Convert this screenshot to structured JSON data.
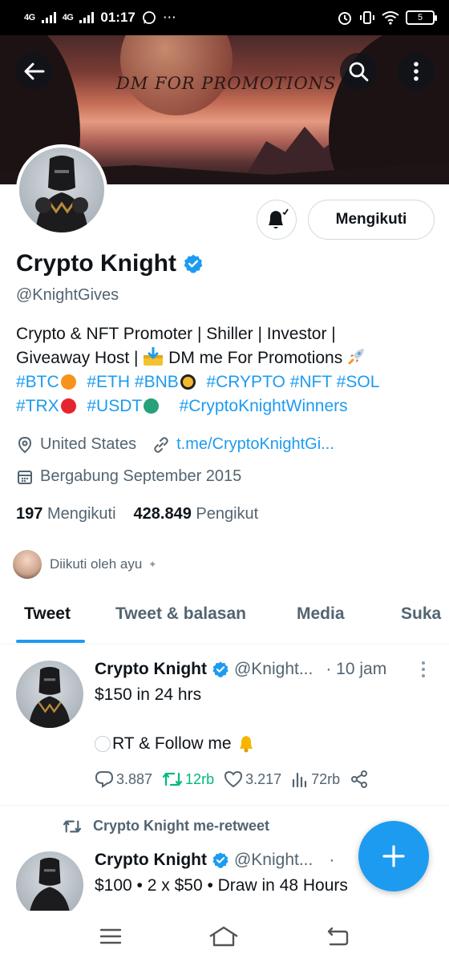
{
  "status_bar": {
    "signal1": "4G",
    "signal2": "4G",
    "time": "01:17",
    "extra": "⋯",
    "battery": "5"
  },
  "banner": {
    "text": "DM FOR PROMOTIONS"
  },
  "profile": {
    "follow_button": "Mengikuti",
    "name": "Crypto Knight",
    "handle": "@KnightGives",
    "bio_line1": "Crypto & NFT Promoter | Shiller | Investor |",
    "bio_line2_a": "Giveaway Host | ",
    "bio_line2_b": " DM me For Promotions ",
    "tags": {
      "btc": "#BTC",
      "eth": "#ETH",
      "bnb": "#BNB",
      "crypto": "#CRYPTO",
      "nft": "#NFT",
      "sol": "#SOL",
      "trx": "#TRX",
      "usdt": "#USDT",
      "winners": "#CryptoKnightWinners"
    },
    "location": "United States",
    "link": "t.me/CryptoKnightGi...",
    "joined": "Bergabung September 2015",
    "following_count": "197",
    "following_label": "Mengikuti",
    "followers_count": "428.849",
    "followers_label": "Pengikut",
    "followed_by": "Diikuti oleh ayu"
  },
  "tabs": [
    "Tweet",
    "Tweet & balasan",
    "Media",
    "Suka"
  ],
  "tweets": [
    {
      "name": "Crypto Knight",
      "handle": "@Knight...",
      "time": "· 10 jam",
      "line1": "$150 in 24 hrs",
      "line2": "RT & Follow me",
      "replies": "3.887",
      "retweets": "12rb",
      "likes": "3.217",
      "views": "72rb"
    },
    {
      "retweeted_by": "Crypto Knight me-retweet",
      "name": "Crypto Knight",
      "handle": "@Knight...",
      "time": "·",
      "line1": "$100 • 2 x $50 • Draw in 48 Hours"
    }
  ],
  "colors": {
    "accent": "#1d9bf0",
    "retweet_green": "#00ba7c",
    "secondary_text": "#536471"
  }
}
